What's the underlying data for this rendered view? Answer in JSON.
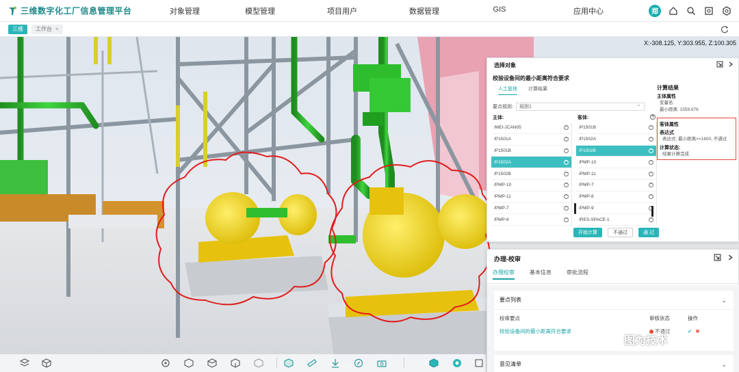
{
  "app": {
    "title": "三维数字化工厂信息管理平台",
    "nav": [
      "对象管理",
      "模型管理",
      "项目用户",
      "数据管理",
      "GIS",
      "应用中心"
    ],
    "user_initial": "郑",
    "accent": "#2ab6b8"
  },
  "tabs": {
    "active": "三维",
    "second": "工作台",
    "second_close": "×"
  },
  "viewport": {
    "coords": "X:-308.125, Y:303.955, Z:100.305"
  },
  "selection_panel": {
    "title": "选择对象",
    "rule_title": "校验设备间的最小距离符合要求",
    "tabs": [
      "人工复核",
      "计算结果"
    ],
    "rule_label": "要点规则:",
    "rule_value": "规则1",
    "main_label": "主体:",
    "guest_label": "客体:",
    "main_items": [
      "/MEI-JCAN05",
      "/P1501A",
      "/P1501B",
      "/P1502A",
      "/P1502B",
      "/PMP-10",
      "/PMP-11",
      "/PMP-7",
      "/PMP-8"
    ],
    "main_selected_index": 3,
    "guest_items": [
      "/P1501B",
      "/P1502A",
      "/P1502B",
      "/PMP-10",
      "/PMP-11",
      "/PMP-7",
      "/PMP-8",
      "/PMP-9",
      "/RES-SPACE-1"
    ],
    "guest_selected_index": 2,
    "buttons": {
      "calc": "开始计算",
      "fail": "不通过",
      "pass": "通 过"
    },
    "result": {
      "title": "计算结果",
      "main_attr_title": "主体属性",
      "var_label": "变量名:",
      "min_distance": "最小距离: 1559.976",
      "guest_attr_title": "客体属性",
      "expr_title": "表达式",
      "expr": "表达式: 最小距离>=1600, 不通过",
      "calc_state_title": "计算状态:",
      "calc_state": "结果计算完成"
    }
  },
  "review_panel": {
    "title": "办理-校审",
    "tabs": [
      "办理校审",
      "基本信息",
      "审批流程"
    ],
    "points_title": "要点列表",
    "columns": [
      "校审要点",
      "审核状态",
      "操作"
    ],
    "row": {
      "point": "校验设备间的最小距离符合要求",
      "status": "不通过"
    },
    "opinion_title": "意见清单"
  },
  "watermark": {
    "text": "图为技术"
  }
}
